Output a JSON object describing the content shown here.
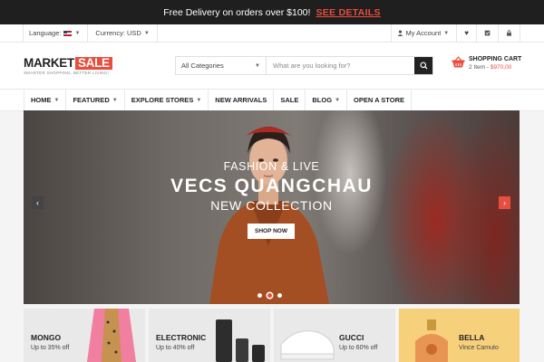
{
  "promo": {
    "text": "Free Delivery on orders over $100!",
    "link": "SEE DETAILS"
  },
  "utility": {
    "language_label": "Language:",
    "currency_label": "Currency: USD",
    "account_label": "My Account"
  },
  "header": {
    "logo_main": "MARKET",
    "logo_accent": "SALE",
    "logo_tagline": "SMARTER SHOPPING, BETTER LIVING!",
    "category_select": "All Categories",
    "search_placeholder": "What are you looking for?",
    "cart_title": "SHOPPING CART",
    "cart_count": "2 Item - ",
    "cart_total": "$970,00"
  },
  "nav": {
    "items": [
      {
        "label": "HOME",
        "dropdown": true
      },
      {
        "label": "FEATURED",
        "dropdown": true
      },
      {
        "label": "EXPLORE STORES",
        "dropdown": true
      },
      {
        "label": "NEW ARRIVALS",
        "dropdown": false
      },
      {
        "label": "SALE",
        "dropdown": false
      },
      {
        "label": "BLOG",
        "dropdown": true
      },
      {
        "label": "OPEN A STORE",
        "dropdown": false
      }
    ]
  },
  "hero": {
    "line1": "FASHION & LIVE",
    "line2": "VECS QUANGCHAU",
    "line3": "NEW COLLECTION",
    "button": "SHOP NOW",
    "slide_count": 3,
    "active_slide": 2
  },
  "categories": [
    {
      "name": "MONGO",
      "sub": "Up to 35% off"
    },
    {
      "name": "ELECTRONIC",
      "sub": "Up to 40% off"
    },
    {
      "name": "GUCCI",
      "sub": "Up to 60% off"
    },
    {
      "name": "BELLA",
      "sub": "Vince Camuto"
    }
  ],
  "colors": {
    "accent": "#e84d3d",
    "dark": "#1f1f1f",
    "bella_bg": "#f7d07c"
  }
}
